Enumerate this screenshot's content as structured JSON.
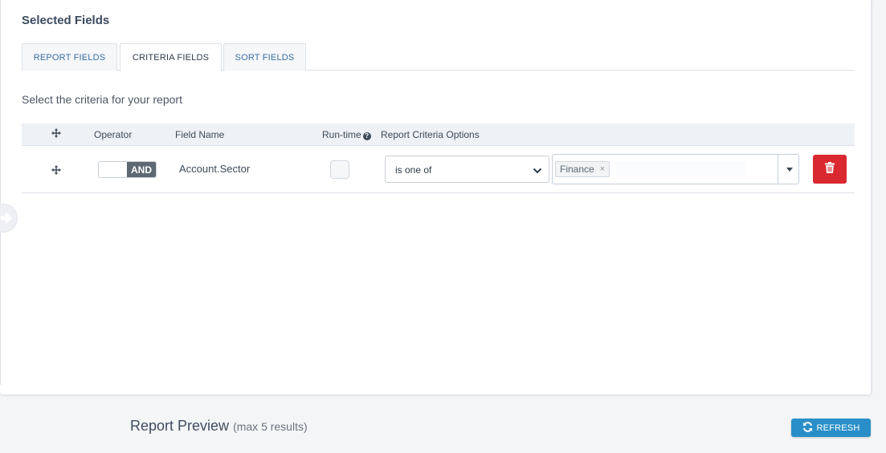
{
  "selected_fields": {
    "title": "Selected Fields",
    "tabs": [
      {
        "label": "REPORT FIELDS",
        "active": false
      },
      {
        "label": "CRITERIA FIELDS",
        "active": true
      },
      {
        "label": "SORT FIELDS",
        "active": false
      }
    ],
    "subtitle": "Select the criteria for your report"
  },
  "criteria_table": {
    "headers": {
      "move_icon": "move-icon",
      "operator": "Operator",
      "field_name": "Field Name",
      "runtime": "Run-time",
      "runtime_help_icon": "question-circle-icon",
      "options": "Report Criteria Options"
    },
    "rows": [
      {
        "move_icon": "move-icon",
        "operator": "AND",
        "field_name": "Account.Sector",
        "runtime_checked": false,
        "condition": "is one of",
        "values": [
          "Finance"
        ],
        "chip_remove": "×",
        "delete_icon": "trash-icon"
      }
    ]
  },
  "preview": {
    "title": "Report Preview",
    "note": "(max 5 results)",
    "refresh_label": "REFRESH",
    "refresh_icon": "refresh-icon"
  },
  "colors": {
    "delete": "#d9282f",
    "refresh": "#2a8fc8",
    "operator_active": "#5d6873"
  }
}
